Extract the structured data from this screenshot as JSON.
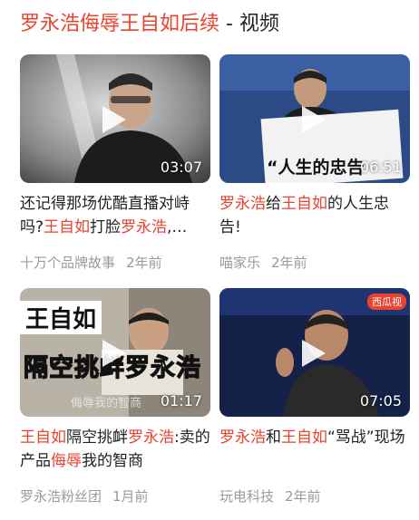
{
  "header": {
    "query": "罗永浩侮辱王自如后续",
    "separator": " - ",
    "section": "视频"
  },
  "colors": {
    "highlight": "#e8432e",
    "meta": "#9a9a9a",
    "text": "#222222"
  },
  "videos": [
    {
      "duration": "03:07",
      "title_parts": [
        {
          "t": "还记得那场优酷直播对峙吗?",
          "hl": false
        },
        {
          "t": "王自如",
          "hl": true
        },
        {
          "t": "打脸",
          "hl": false
        },
        {
          "t": "罗永浩",
          "hl": true
        },
        {
          "t": ",…",
          "hl": false
        }
      ],
      "author": "十万个品牌故事",
      "time": "2年前"
    },
    {
      "duration": "06:51",
      "thumb_caption": "“人生的忠告",
      "title_parts": [
        {
          "t": "罗永浩",
          "hl": true
        },
        {
          "t": "给",
          "hl": false
        },
        {
          "t": "王自如",
          "hl": true
        },
        {
          "t": "的人生忠告!",
          "hl": false
        }
      ],
      "author": "喵家乐",
      "time": "2年前"
    },
    {
      "duration": "01:17",
      "thumb_caption_top": "王自如",
      "thumb_caption_bottom": "隔空挑衅罗永浩",
      "thumb_caption_small": "侮辱我的智商",
      "title_parts": [
        {
          "t": "王自如",
          "hl": true
        },
        {
          "t": "隔空挑衅",
          "hl": false
        },
        {
          "t": "罗永浩",
          "hl": true
        },
        {
          "t": ":卖的产品",
          "hl": false
        },
        {
          "t": "侮辱",
          "hl": true
        },
        {
          "t": "我的智商",
          "hl": false
        }
      ],
      "author": "罗永浩粉丝团",
      "time": "1月前"
    },
    {
      "duration": "07:05",
      "thumb_logo": "西瓜视",
      "title_parts": [
        {
          "t": "罗永浩",
          "hl": true
        },
        {
          "t": "和",
          "hl": false
        },
        {
          "t": "王自如",
          "hl": true
        },
        {
          "t": "“骂战”现场",
          "hl": false
        }
      ],
      "author": "玩电科技",
      "time": "2年前"
    }
  ]
}
